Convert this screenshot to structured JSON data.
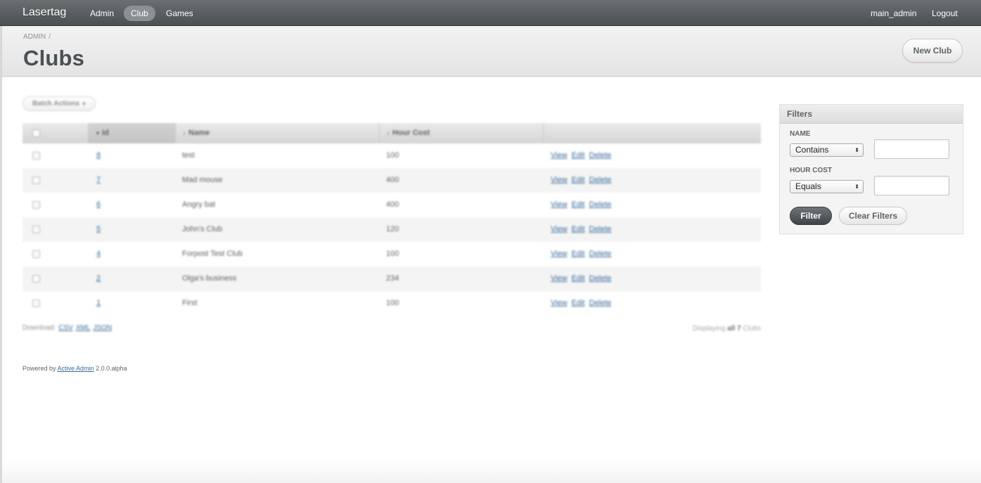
{
  "app": {
    "brand": "Lasertag",
    "nav": [
      {
        "label": "Admin",
        "active": false
      },
      {
        "label": "Club",
        "active": true
      },
      {
        "label": "Games",
        "active": false
      }
    ],
    "user": "main_admin",
    "logout": "Logout"
  },
  "title_bar": {
    "breadcrumb": "ADMIN",
    "breadcrumb_sep": "/",
    "title": "Clubs",
    "new_button": "New Club"
  },
  "index": {
    "batch_actions": "Batch Actions",
    "batch_caret": "▾",
    "columns": {
      "id": "Id",
      "name": "Name",
      "hour_cost": "Hour Cost",
      "sort_icon": "▾",
      "sort_icon_alt": "↕"
    },
    "rows": [
      {
        "id": "8",
        "name": "test",
        "hour_cost": "100"
      },
      {
        "id": "7",
        "name": "Mad mouse",
        "hour_cost": "400"
      },
      {
        "id": "6",
        "name": "Angry bat",
        "hour_cost": "400"
      },
      {
        "id": "5",
        "name": "John's Club",
        "hour_cost": "120"
      },
      {
        "id": "4",
        "name": "Forpost Test Club",
        "hour_cost": "100"
      },
      {
        "id": "2",
        "name": "Olga's business",
        "hour_cost": "234"
      },
      {
        "id": "1",
        "name": "First",
        "hour_cost": "100"
      }
    ],
    "row_actions": {
      "view": "View",
      "edit": "Edit",
      "delete": "Delete"
    },
    "download_label": "Download:",
    "download_formats": [
      "CSV",
      "XML",
      "JSON"
    ],
    "display_prefix": "Displaying",
    "display_all": "all 7",
    "display_suffix": "Clubs"
  },
  "footer": {
    "prefix": "Powered by",
    "link": "Active Admin",
    "version": "2.0.0.alpha"
  },
  "filters": {
    "title": "Filters",
    "name_label": "NAME",
    "name_operator": "Contains",
    "name_value": "",
    "hour_cost_label": "HOUR COST",
    "hour_cost_operator": "Equals",
    "hour_cost_value": "",
    "select_arrow": "⬍",
    "filter_button": "Filter",
    "clear_button": "Clear Filters"
  }
}
